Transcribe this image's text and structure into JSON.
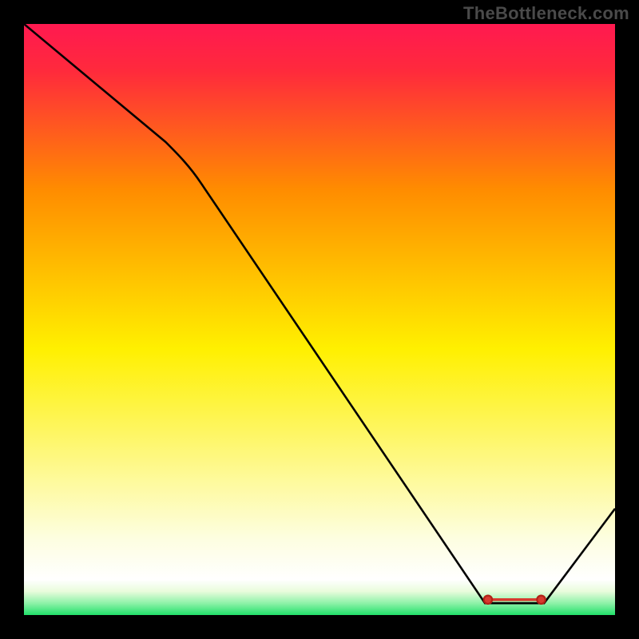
{
  "watermark": "TheBottleneck.com",
  "chart_data": {
    "type": "line",
    "title": "",
    "xlabel": "",
    "ylabel": "",
    "xlim": [
      0,
      100
    ],
    "ylim": [
      0,
      100
    ],
    "series": [
      {
        "name": "curve",
        "x": [
          0,
          24,
          78,
          88,
          100
        ],
        "values": [
          100,
          80,
          2,
          2,
          18
        ]
      }
    ],
    "optimal_marker": {
      "x_start": 78,
      "x_end": 88,
      "y": 2
    },
    "gradient_stops_vertical_pct_from_bottom": {
      "green": 0,
      "pale_green": 3,
      "white": 6,
      "pale_yellow": 13,
      "yellow": 45,
      "orange": 72,
      "red": 100
    }
  }
}
